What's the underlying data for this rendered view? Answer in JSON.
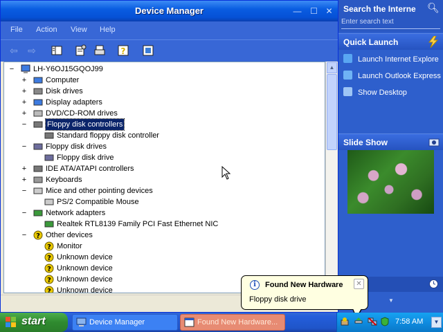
{
  "window": {
    "title": "Device Manager",
    "controls": {
      "minimize": "—",
      "maximize": "☐",
      "close": "✕"
    }
  },
  "menu": [
    "File",
    "Action",
    "View",
    "Help"
  ],
  "toolbar": {
    "icons": [
      "back-icon",
      "forward-icon",
      "show-hide-console-tree-icon",
      "properties-icon",
      "print-icon",
      "help-icon",
      "scan-hardware-icon"
    ]
  },
  "tree": {
    "root": "LH-Y6OJ15GQOJ99",
    "nodes": [
      {
        "label": "Computer",
        "state": "+",
        "level": 1,
        "icon": "computer-icon",
        "color": "#3d7be0"
      },
      {
        "label": "Disk drives",
        "state": "+",
        "level": 1,
        "icon": "disk-drive-icon",
        "color": "#888888"
      },
      {
        "label": "Display adapters",
        "state": "+",
        "level": 1,
        "icon": "display-adapter-icon",
        "color": "#3d7be0"
      },
      {
        "label": "DVD/CD-ROM drives",
        "state": "+",
        "level": 1,
        "icon": "cdrom-icon",
        "color": "#bbbbbb"
      },
      {
        "label": "Floppy disk controllers",
        "state": "−",
        "level": 1,
        "icon": "floppy-controller-icon",
        "color": "#777777",
        "selected": true
      },
      {
        "label": "Standard floppy disk controller",
        "state": "",
        "level": 2,
        "icon": "floppy-controller-icon",
        "color": "#777777"
      },
      {
        "label": "Floppy disk drives",
        "state": "−",
        "level": 1,
        "icon": "floppy-drive-icon",
        "color": "#6d6d9d"
      },
      {
        "label": "Floppy disk drive",
        "state": "",
        "level": 2,
        "icon": "floppy-drive-icon",
        "color": "#6d6d9d"
      },
      {
        "label": "IDE ATA/ATAPI controllers",
        "state": "+",
        "level": 1,
        "icon": "ide-controller-icon",
        "color": "#777777"
      },
      {
        "label": "Keyboards",
        "state": "+",
        "level": 1,
        "icon": "keyboard-icon",
        "color": "#999999"
      },
      {
        "label": "Mice and other pointing devices",
        "state": "−",
        "level": 1,
        "icon": "mouse-icon",
        "color": "#cccccc"
      },
      {
        "label": "PS/2 Compatible Mouse",
        "state": "",
        "level": 2,
        "icon": "mouse-icon",
        "color": "#cccccc"
      },
      {
        "label": "Network adapters",
        "state": "−",
        "level": 1,
        "icon": "network-adapter-icon",
        "color": "#3b9a3b"
      },
      {
        "label": "Realtek RTL8139 Family PCI Fast Ethernet NIC",
        "state": "",
        "level": 2,
        "icon": "network-adapter-icon",
        "color": "#3b9a3b"
      },
      {
        "label": "Other devices",
        "state": "−",
        "level": 1,
        "icon": "unknown-device-icon",
        "color": "#e8c800"
      },
      {
        "label": "Monitor",
        "state": "",
        "level": 2,
        "icon": "unknown-device-icon",
        "color": "#e8c800"
      },
      {
        "label": "Unknown device",
        "state": "",
        "level": 2,
        "icon": "unknown-device-icon",
        "color": "#e8c800"
      },
      {
        "label": "Unknown device",
        "state": "",
        "level": 2,
        "icon": "unknown-device-icon",
        "color": "#e8c800"
      },
      {
        "label": "Unknown device",
        "state": "",
        "level": 2,
        "icon": "unknown-device-icon",
        "color": "#e8c800"
      },
      {
        "label": "Unknown device",
        "state": "",
        "level": 2,
        "icon": "unknown-device-icon",
        "color": "#e8c800"
      }
    ]
  },
  "sidebar": {
    "search_title": "Search the Interne",
    "search_placeholder": "Enter search text",
    "quick_launch_title": "Quick Launch",
    "quick_launch_items": [
      {
        "label": "Launch Internet Explore",
        "icon": "internet-explorer-icon",
        "color": "#59a6f2"
      },
      {
        "label": "Launch Outlook Express",
        "icon": "outlook-express-icon",
        "color": "#6fb3f5"
      },
      {
        "label": "Show Desktop",
        "icon": "show-desktop-icon",
        "color": "#9ec5f5"
      }
    ],
    "slide_show_title": "Slide Show"
  },
  "balloon": {
    "title": "Found New Hardware",
    "message": "Floppy disk drive",
    "close": "✕",
    "info": "i"
  },
  "taskbar": {
    "start_label": "start",
    "tasks": [
      {
        "label": "Device Manager",
        "active": false
      },
      {
        "label": "Found New Hardware...",
        "active": true
      }
    ],
    "clock": "7:58 AM"
  },
  "colors": {
    "title_blue": "#0a5de1",
    "selection": "#0a246a",
    "start_green": "#3c983c",
    "tray_blue": "#0f8ce0"
  }
}
